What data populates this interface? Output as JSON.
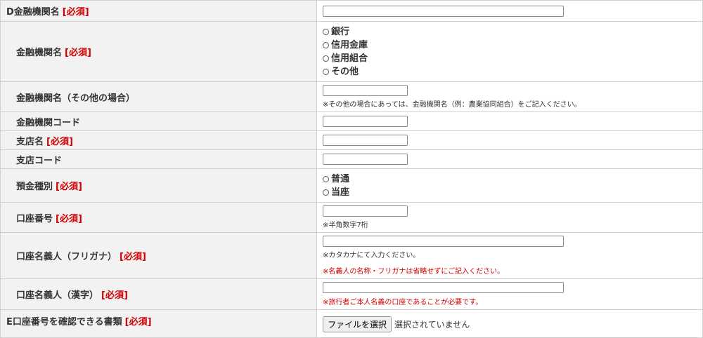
{
  "required_tag": "[必須]",
  "rows": {
    "d_bank_name": {
      "label": "D金融機関名"
    },
    "bank_type": {
      "label": "金融機関名",
      "options": [
        "銀行",
        "信用金庫",
        "信用組合",
        "その他"
      ]
    },
    "bank_other": {
      "label": "金融機関名（その他の場合）",
      "note": "※その他の場合にあっては、金融機関名（例：農業協同組合）をご記入ください。"
    },
    "bank_code": {
      "label": "金融機関コード"
    },
    "branch_name": {
      "label": "支店名"
    },
    "branch_code": {
      "label": "支店コード"
    },
    "deposit_type": {
      "label": "預金種別",
      "options": [
        "普通",
        "当座"
      ]
    },
    "account_number": {
      "label": "口座番号",
      "note": "※半角数字7桁"
    },
    "holder_kana": {
      "label": "口座名義人（フリガナ）",
      "note": "※カタカナにて入力ください。",
      "note_red": "※名義人の名称・フリガナは省略せずにご記入ください。"
    },
    "holder_kanji": {
      "label": "口座名義人（漢字）",
      "note_red": "※旅行者ご本人名義の口座であることが必要です。"
    },
    "e_document": {
      "label": "E口座番号を確認できる書類",
      "button": "ファイルを選択",
      "status": "選択されていません"
    }
  }
}
